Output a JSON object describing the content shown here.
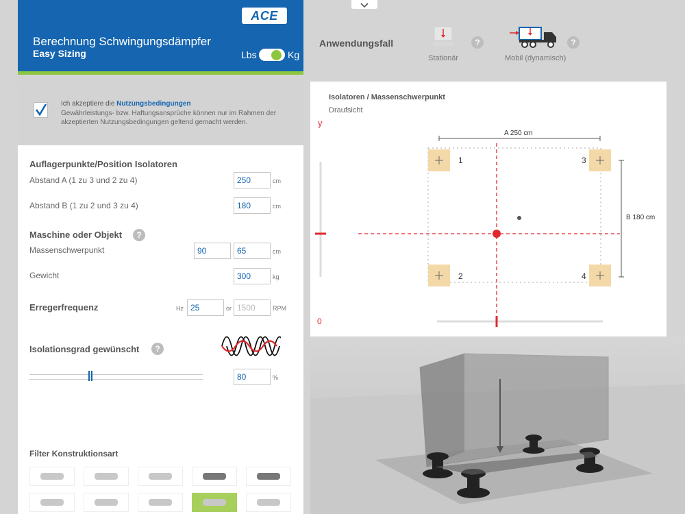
{
  "header": {
    "logo": "ACE",
    "title": "Berechnung Schwingungsdämpfer",
    "subtitle": "Easy Sizing",
    "unit_left": "Lbs",
    "unit_right": "Kg",
    "accent": "#1565b0",
    "green": "#8cc63f"
  },
  "application": {
    "label": "Anwendungsfall",
    "options": [
      {
        "label": "Stationär",
        "icon": "stationary-icon"
      },
      {
        "label": "Mobil (dynamisch)",
        "icon": "truck-icon"
      }
    ],
    "help": "?"
  },
  "terms": {
    "prefix": "Ich akzeptiere die ",
    "link": "Nutzungsbedingungen",
    "text": "Gewährleistungs- bzw. Haftungsansprüche können nur im Rahmen der akzeptierten Nutzungsbedingungen geltend gemacht werden.",
    "checked": true
  },
  "form": {
    "support_title": "Auflagerpunkte/Position Isolatoren",
    "distance_a_label": "Abstand A (1 zu 3 und 2 zu 4)",
    "distance_a": "250",
    "distance_b_label": "Abstand B (1 zu 2 und 3 zu 4)",
    "distance_b": "180",
    "unit_cm": "cm",
    "machine_title": "Maschine oder Objekt",
    "cog_label": "Massenschwerpunkt",
    "cog_x": "90",
    "cog_y": "65",
    "weight_label": "Gewicht",
    "weight": "300",
    "unit_kg": "kg",
    "freq_title": "Erregerfrequenz",
    "freq_hz_label": "Hz",
    "freq_hz": "25",
    "freq_or": "or",
    "freq_rpm": "1500",
    "freq_rpm_label": "RPM",
    "isolation_title": "Isolationsgrad gewünscht",
    "isolation_value": "80",
    "isolation_unit": "%",
    "isolation_slider_fraction": 0.35,
    "filter_title": "Filter Konstruktionsart",
    "help": "?"
  },
  "diagram": {
    "title": "Isolatoren / Massenschwerpunkt",
    "subtitle": "Draufsicht",
    "y_axis": "y",
    "origin": "0",
    "dim_a": "A 250 cm",
    "dim_b": "B 180 cm",
    "isolators": [
      "1",
      "2",
      "3",
      "4"
    ]
  },
  "icons": {
    "chevron": "chevron-down-icon",
    "checkbox": "checkmark-icon",
    "wave": "sine-wave-icon"
  }
}
